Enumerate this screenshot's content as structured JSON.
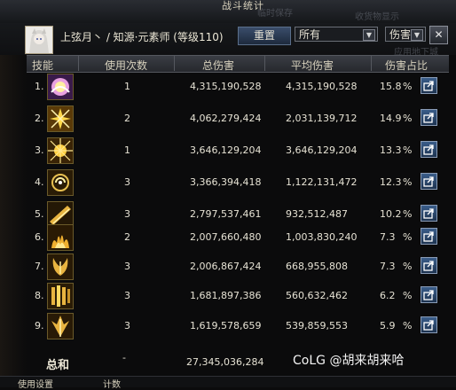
{
  "window": {
    "title": "战斗统计"
  },
  "header": {
    "character": "上弦月丶 / 知源·元素师 (等级110)",
    "reset_label": "重置",
    "filter1": "所有",
    "filter2": "伤害"
  },
  "columns": [
    "技能",
    "使用次数",
    "总伤害",
    "平均伤害",
    "伤害占比"
  ],
  "rows": [
    {
      "rank": "1.",
      "uses": "1",
      "total": "4,315,190,528",
      "avg": "4,315,190,528",
      "pct": "15.8",
      "unit": "%"
    },
    {
      "rank": "2.",
      "uses": "2",
      "total": "4,062,279,424",
      "avg": "2,031,139,712",
      "pct": "14.9",
      "unit": "%"
    },
    {
      "rank": "3.",
      "uses": "1",
      "total": "3,646,129,204",
      "avg": "3,646,129,204",
      "pct": "13.3",
      "unit": "%"
    },
    {
      "rank": "4.",
      "uses": "3",
      "total": "3,366,394,418",
      "avg": "1,122,131,472",
      "pct": "12.3",
      "unit": "%"
    },
    {
      "rank": "5.",
      "uses": "3",
      "total": "2,797,537,461",
      "avg": "932,512,487",
      "pct": "10.2",
      "unit": "%"
    },
    {
      "rank": "6.",
      "uses": "2",
      "total": "2,007,660,480",
      "avg": "1,003,830,240",
      "pct": "7.3",
      "unit": "%"
    },
    {
      "rank": "7.",
      "uses": "3",
      "total": "2,006,867,424",
      "avg": "668,955,808",
      "pct": "7.3",
      "unit": "%"
    },
    {
      "rank": "8.",
      "uses": "3",
      "total": "1,681,897,386",
      "avg": "560,632,462",
      "pct": "6.2",
      "unit": "%"
    },
    {
      "rank": "9.",
      "uses": "3",
      "total": "1,619,578,659",
      "avg": "539,859,553",
      "pct": "5.9",
      "unit": "%"
    }
  ],
  "total": {
    "label": "总和",
    "uses": "-",
    "damage": "27,345,036,284"
  },
  "watermark": "CoLG @胡来胡来哈",
  "bottom": {
    "left": "使用设置",
    "right": "计数"
  },
  "ghost_text": {
    "a": "临时保存",
    "b": "收货物显示",
    "c": "应用地下城"
  },
  "colors": {
    "gold": "#d8b040",
    "accent_blue": "#3a5d8a"
  }
}
